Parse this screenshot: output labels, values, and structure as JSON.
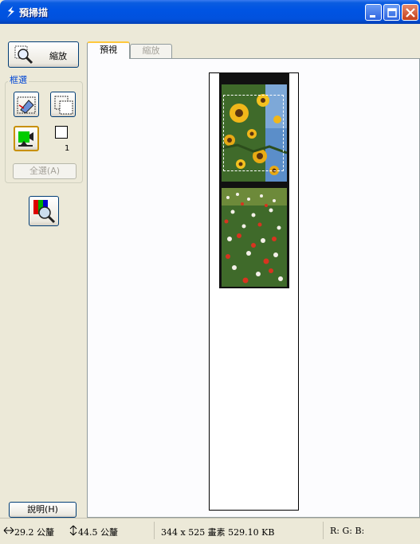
{
  "window": {
    "title": "預掃描"
  },
  "toolbar": {
    "zoom_label": "縮放",
    "group_label": "框選",
    "count": "1",
    "select_all_label": "全選(A)",
    "help_label": "說明(H)"
  },
  "tabs": [
    {
      "label": "預視",
      "active": true
    },
    {
      "label": "縮放",
      "active": false
    }
  ],
  "status": {
    "width": "29.2 公釐",
    "height": "44.5 公釐",
    "image_info": "344 x 525 畫素 529.10 KB",
    "rgb": "R: G: B:"
  },
  "colors": {
    "titlebar": "#0054e3",
    "accent": "#0046d5",
    "tab_highlight": "#ffc83c"
  },
  "icons": [
    "app-icon",
    "magnifier-icon",
    "marquee-delete-icon",
    "marquee-duplicate-icon",
    "image-type-icon",
    "auto-locate-icon",
    "minimize-icon",
    "maximize-icon",
    "close-icon",
    "horizontal-arrow-icon",
    "vertical-arrow-icon"
  ]
}
